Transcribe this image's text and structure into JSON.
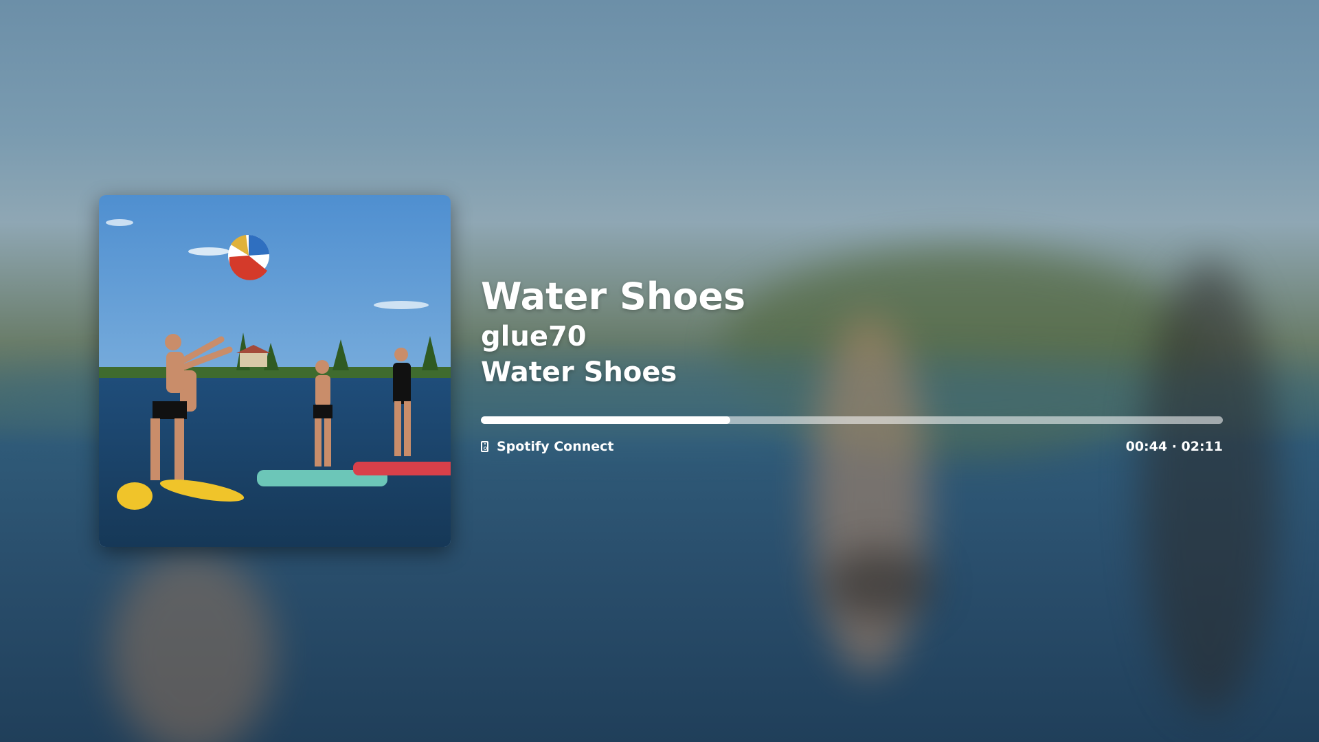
{
  "track": {
    "title": "Water Shoes",
    "artist": "glue70",
    "album": "Water Shoes"
  },
  "playback": {
    "device_label": "Spotify Connect",
    "device_icon": "speaker-icon",
    "time_display": "00:44 · 02:11",
    "progress_fraction": 0.336
  },
  "album_art": {
    "description_icon": "album-art-image"
  },
  "colors": {
    "progress_fill": "#ffffff",
    "progress_track": "rgba(255,255,255,0.55)"
  }
}
